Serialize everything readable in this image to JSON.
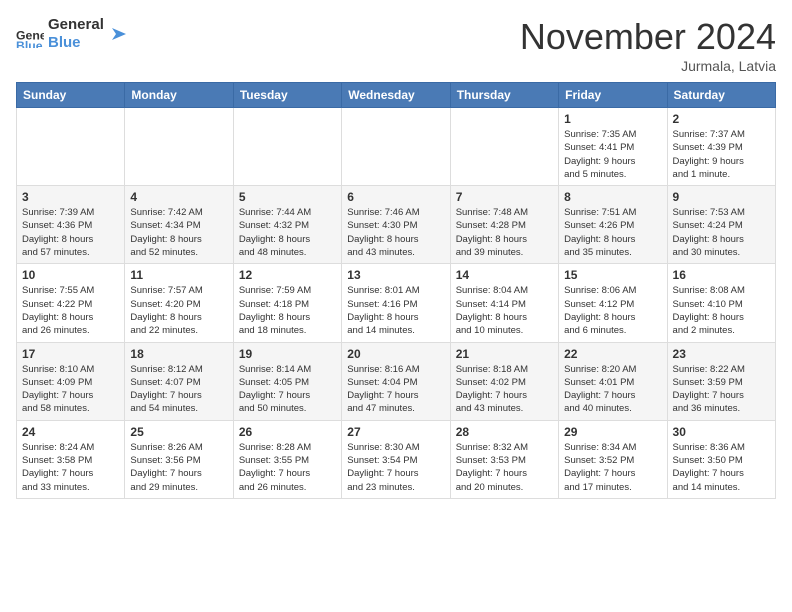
{
  "logo": {
    "general": "General",
    "blue": "Blue"
  },
  "title": "November 2024",
  "location": "Jurmala, Latvia",
  "days_header": [
    "Sunday",
    "Monday",
    "Tuesday",
    "Wednesday",
    "Thursday",
    "Friday",
    "Saturday"
  ],
  "weeks": [
    [
      {
        "day": "",
        "info": ""
      },
      {
        "day": "",
        "info": ""
      },
      {
        "day": "",
        "info": ""
      },
      {
        "day": "",
        "info": ""
      },
      {
        "day": "",
        "info": ""
      },
      {
        "day": "1",
        "info": "Sunrise: 7:35 AM\nSunset: 4:41 PM\nDaylight: 9 hours\nand 5 minutes."
      },
      {
        "day": "2",
        "info": "Sunrise: 7:37 AM\nSunset: 4:39 PM\nDaylight: 9 hours\nand 1 minute."
      }
    ],
    [
      {
        "day": "3",
        "info": "Sunrise: 7:39 AM\nSunset: 4:36 PM\nDaylight: 8 hours\nand 57 minutes."
      },
      {
        "day": "4",
        "info": "Sunrise: 7:42 AM\nSunset: 4:34 PM\nDaylight: 8 hours\nand 52 minutes."
      },
      {
        "day": "5",
        "info": "Sunrise: 7:44 AM\nSunset: 4:32 PM\nDaylight: 8 hours\nand 48 minutes."
      },
      {
        "day": "6",
        "info": "Sunrise: 7:46 AM\nSunset: 4:30 PM\nDaylight: 8 hours\nand 43 minutes."
      },
      {
        "day": "7",
        "info": "Sunrise: 7:48 AM\nSunset: 4:28 PM\nDaylight: 8 hours\nand 39 minutes."
      },
      {
        "day": "8",
        "info": "Sunrise: 7:51 AM\nSunset: 4:26 PM\nDaylight: 8 hours\nand 35 minutes."
      },
      {
        "day": "9",
        "info": "Sunrise: 7:53 AM\nSunset: 4:24 PM\nDaylight: 8 hours\nand 30 minutes."
      }
    ],
    [
      {
        "day": "10",
        "info": "Sunrise: 7:55 AM\nSunset: 4:22 PM\nDaylight: 8 hours\nand 26 minutes."
      },
      {
        "day": "11",
        "info": "Sunrise: 7:57 AM\nSunset: 4:20 PM\nDaylight: 8 hours\nand 22 minutes."
      },
      {
        "day": "12",
        "info": "Sunrise: 7:59 AM\nSunset: 4:18 PM\nDaylight: 8 hours\nand 18 minutes."
      },
      {
        "day": "13",
        "info": "Sunrise: 8:01 AM\nSunset: 4:16 PM\nDaylight: 8 hours\nand 14 minutes."
      },
      {
        "day": "14",
        "info": "Sunrise: 8:04 AM\nSunset: 4:14 PM\nDaylight: 8 hours\nand 10 minutes."
      },
      {
        "day": "15",
        "info": "Sunrise: 8:06 AM\nSunset: 4:12 PM\nDaylight: 8 hours\nand 6 minutes."
      },
      {
        "day": "16",
        "info": "Sunrise: 8:08 AM\nSunset: 4:10 PM\nDaylight: 8 hours\nand 2 minutes."
      }
    ],
    [
      {
        "day": "17",
        "info": "Sunrise: 8:10 AM\nSunset: 4:09 PM\nDaylight: 7 hours\nand 58 minutes."
      },
      {
        "day": "18",
        "info": "Sunrise: 8:12 AM\nSunset: 4:07 PM\nDaylight: 7 hours\nand 54 minutes."
      },
      {
        "day": "19",
        "info": "Sunrise: 8:14 AM\nSunset: 4:05 PM\nDaylight: 7 hours\nand 50 minutes."
      },
      {
        "day": "20",
        "info": "Sunrise: 8:16 AM\nSunset: 4:04 PM\nDaylight: 7 hours\nand 47 minutes."
      },
      {
        "day": "21",
        "info": "Sunrise: 8:18 AM\nSunset: 4:02 PM\nDaylight: 7 hours\nand 43 minutes."
      },
      {
        "day": "22",
        "info": "Sunrise: 8:20 AM\nSunset: 4:01 PM\nDaylight: 7 hours\nand 40 minutes."
      },
      {
        "day": "23",
        "info": "Sunrise: 8:22 AM\nSunset: 3:59 PM\nDaylight: 7 hours\nand 36 minutes."
      }
    ],
    [
      {
        "day": "24",
        "info": "Sunrise: 8:24 AM\nSunset: 3:58 PM\nDaylight: 7 hours\nand 33 minutes."
      },
      {
        "day": "25",
        "info": "Sunrise: 8:26 AM\nSunset: 3:56 PM\nDaylight: 7 hours\nand 29 minutes."
      },
      {
        "day": "26",
        "info": "Sunrise: 8:28 AM\nSunset: 3:55 PM\nDaylight: 7 hours\nand 26 minutes."
      },
      {
        "day": "27",
        "info": "Sunrise: 8:30 AM\nSunset: 3:54 PM\nDaylight: 7 hours\nand 23 minutes."
      },
      {
        "day": "28",
        "info": "Sunrise: 8:32 AM\nSunset: 3:53 PM\nDaylight: 7 hours\nand 20 minutes."
      },
      {
        "day": "29",
        "info": "Sunrise: 8:34 AM\nSunset: 3:52 PM\nDaylight: 7 hours\nand 17 minutes."
      },
      {
        "day": "30",
        "info": "Sunrise: 8:36 AM\nSunset: 3:50 PM\nDaylight: 7 hours\nand 14 minutes."
      }
    ]
  ]
}
